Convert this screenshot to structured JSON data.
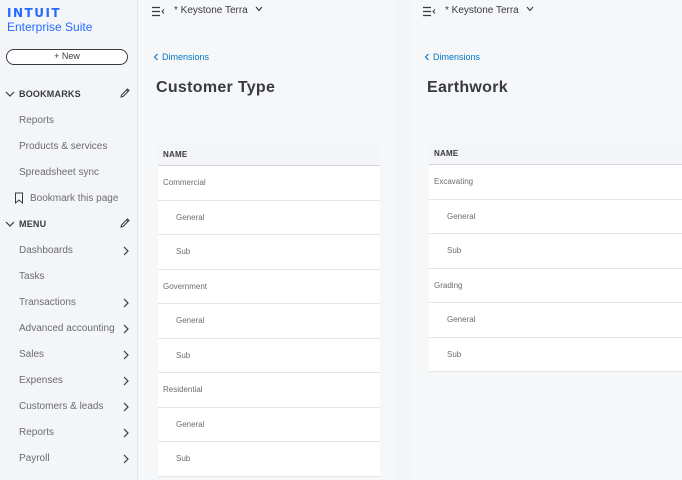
{
  "sidebar": {
    "brand": "INTUIT",
    "product": "Enterprise Suite",
    "new_label": "+ New",
    "bookmarks_title": "BOOKMARKS",
    "bookmarks": [
      {
        "label": "Reports"
      },
      {
        "label": "Products & services"
      },
      {
        "label": "Spreadsheet sync"
      }
    ],
    "bookmark_this_page": "Bookmark this page",
    "menu_title": "MENU",
    "menu": [
      {
        "label": "Dashboards",
        "has_arrow": true
      },
      {
        "label": "Tasks",
        "has_arrow": false
      },
      {
        "label": "Transactions",
        "has_arrow": true
      },
      {
        "label": "Advanced accounting",
        "has_arrow": true
      },
      {
        "label": "Sales",
        "has_arrow": true
      },
      {
        "label": "Expenses",
        "has_arrow": true
      },
      {
        "label": "Customers & leads",
        "has_arrow": true
      },
      {
        "label": "Reports",
        "has_arrow": true
      },
      {
        "label": "Payroll",
        "has_arrow": true
      }
    ]
  },
  "panels": [
    {
      "company": "* Keystone Terra",
      "breadcrumb": "Dimensions",
      "title": "Customer Type",
      "column": "NAME",
      "rows": [
        {
          "label": "Commercial",
          "level": "parent"
        },
        {
          "label": "General",
          "level": "child"
        },
        {
          "label": "Sub",
          "level": "child"
        },
        {
          "label": "Government",
          "level": "parent"
        },
        {
          "label": "General",
          "level": "child"
        },
        {
          "label": "Sub",
          "level": "child"
        },
        {
          "label": "Residential",
          "level": "parent"
        },
        {
          "label": "General",
          "level": "child"
        },
        {
          "label": "Sub",
          "level": "child"
        }
      ]
    },
    {
      "company": "* Keystone Terra",
      "breadcrumb": "Dimensions",
      "title": "Earthwork",
      "column": "NAME",
      "rows": [
        {
          "label": "Excavating",
          "level": "parent"
        },
        {
          "label": "General",
          "level": "child"
        },
        {
          "label": "Sub",
          "level": "child"
        },
        {
          "label": "Grading",
          "level": "parent"
        },
        {
          "label": "General",
          "level": "child"
        },
        {
          "label": "Sub",
          "level": "child"
        }
      ]
    }
  ],
  "colors": {
    "brand_blue": "#236cff",
    "link_blue": "#0077c5",
    "text": "#393a3d",
    "muted": "#6b6c72"
  }
}
